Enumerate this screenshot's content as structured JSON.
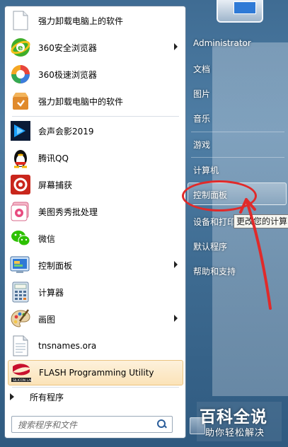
{
  "left_menu": {
    "items": [
      {
        "label": "强力卸载电脑上的软件",
        "icon": "blank-document-icon",
        "arrow": false
      },
      {
        "label": "360安全浏览器",
        "icon": "360-safe-browser-icon",
        "arrow": true
      },
      {
        "label": "360极速浏览器",
        "icon": "360-speed-browser-icon",
        "arrow": false
      },
      {
        "label": "强力卸载电脑中的软件",
        "icon": "uninstall-box-icon",
        "arrow": false
      },
      {
        "label": "会声会影2019",
        "icon": "video-studio-icon",
        "arrow": false
      },
      {
        "label": "腾讯QQ",
        "icon": "qq-penguin-icon",
        "arrow": false
      },
      {
        "label": "屏幕捕获",
        "icon": "screen-capture-icon",
        "arrow": false
      },
      {
        "label": "美图秀秀批处理",
        "icon": "meitu-batch-icon",
        "arrow": false
      },
      {
        "label": "微信",
        "icon": "wechat-icon",
        "arrow": false
      },
      {
        "label": "控制面板",
        "icon": "control-panel-icon",
        "arrow": true
      },
      {
        "label": "计算器",
        "icon": "calculator-icon",
        "arrow": false
      },
      {
        "label": "画图",
        "icon": "paint-palette-icon",
        "arrow": true
      },
      {
        "label": "tnsnames.ora",
        "icon": "file-document-icon",
        "arrow": false
      },
      {
        "label": "FLASH Programming Utility",
        "icon": "silicon-labs-icon",
        "arrow": false,
        "highlighted": true
      }
    ],
    "all_programs": "所有程序",
    "search_placeholder": "搜索程序和文件"
  },
  "right_menu": {
    "items": [
      {
        "label": "Administrator"
      },
      {
        "label": "文档"
      },
      {
        "label": "图片"
      },
      {
        "label": "音乐"
      },
      {
        "label": "游戏"
      },
      {
        "label": "计算机"
      },
      {
        "label": "控制面板",
        "highlighted": true
      },
      {
        "label": "设备和打印"
      },
      {
        "label": "默认程序"
      },
      {
        "label": "帮助和支持"
      }
    ],
    "tooltip": "更改您的计算"
  },
  "watermark": {
    "title": "百科全说",
    "subtitle": "助你轻松解决"
  },
  "colors": {
    "annotation_red": "#e02a2a",
    "highlight_orange": "#fbe3b8"
  }
}
